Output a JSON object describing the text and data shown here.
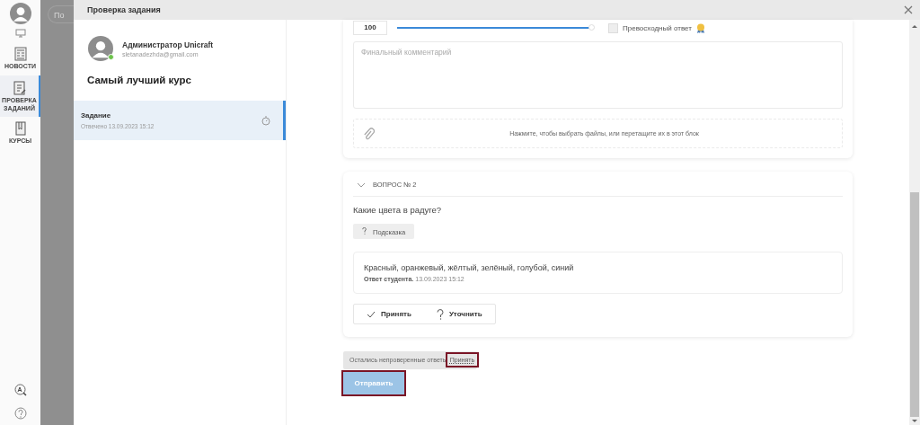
{
  "sidebar": {
    "items": [
      {
        "kind": "screen",
        "selected": false
      },
      {
        "kind": "news",
        "label": "НОВОСТИ",
        "selected": false
      },
      {
        "kind": "review",
        "label": "ПРОВЕРКА ЗАДАНИЙ",
        "selected": true
      },
      {
        "kind": "courses",
        "label": "КУРСЫ",
        "selected": false
      }
    ]
  },
  "background": {
    "search_placeholder": "По"
  },
  "dialog": {
    "title": "Проверка задания",
    "user": {
      "name": "Администратор Unicraft",
      "email": "sletanadezhda@gmail.com",
      "online": true
    },
    "course": "Самый лучший курс",
    "tasks": [
      {
        "title": "Задание",
        "answered": "Отвечено 13.09.2023 15:12",
        "selected": true
      }
    ],
    "grading": {
      "score": "100",
      "level": 1,
      "excellent_label": "Превосходный ответ",
      "excellent_checked": false,
      "comment_placeholder": "Финальный комментарий",
      "upload_hint": "Нажмите, чтобы выбрать файлы, или перетащите их в этот блок"
    },
    "question": {
      "heading": "ВОПРОС № 2",
      "expanded": true,
      "text": "Какие цвета в радуге?",
      "hint_button": "Подсказка",
      "answer": "Красный, оранжевый, жёлтый, зелёный, голубой, синий",
      "answer_label": "Ответ студента.",
      "answer_time": "13.09.2023 15:12",
      "actions": [
        {
          "kind": "accept",
          "label": "Принять"
        },
        {
          "kind": "clarify",
          "label": "Уточнить"
        }
      ]
    },
    "notice": {
      "text": "Остались непроверенные ответы",
      "link": "Принять",
      "highlighted": true
    },
    "submit": {
      "label": "Отправить",
      "highlighted": true
    }
  }
}
